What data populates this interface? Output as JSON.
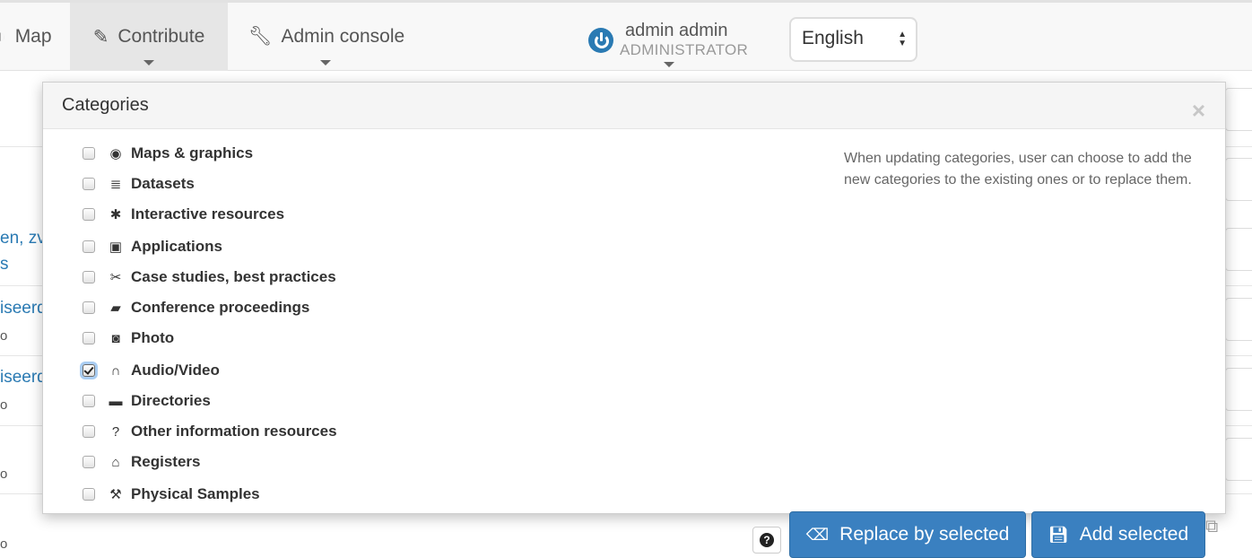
{
  "navbar": {
    "map_label": "Map",
    "contribute_label": "Contribute",
    "admin_label": "Admin console",
    "user_name": "admin admin",
    "user_role": "ADMINISTRATOR",
    "language": "English"
  },
  "background": {
    "link1": "en, zv",
    "link1b": "s",
    "link2": "iseerd",
    "link3": "iseerd",
    "small": "o"
  },
  "modal": {
    "title": "Categories",
    "close": "×",
    "help_text": "When updating categories, user can choose to add the new categories to the existing ones or to replace them.",
    "categories": [
      {
        "label": "Maps & graphics",
        "icon": "globe-icon",
        "checked": false
      },
      {
        "label": "Datasets",
        "icon": "database-icon",
        "checked": false
      },
      {
        "label": "Interactive resources",
        "icon": "gear-icon",
        "checked": false
      },
      {
        "label": "Applications",
        "icon": "floppy-disk-icon",
        "checked": false
      },
      {
        "label": "Case studies, best practices",
        "icon": "paperclip-icon",
        "checked": false
      },
      {
        "label": "Conference proceedings",
        "icon": "book-icon",
        "checked": false
      },
      {
        "label": "Photo",
        "icon": "camera-icon",
        "checked": false
      },
      {
        "label": "Audio/Video",
        "icon": "headphones-icon",
        "checked": true
      },
      {
        "label": "Directories",
        "icon": "folder-icon",
        "checked": false
      },
      {
        "label": "Other information resources",
        "icon": "question-icon",
        "checked": false
      },
      {
        "label": "Registers",
        "icon": "institution-icon",
        "checked": false
      },
      {
        "label": "Physical Samples",
        "icon": "wrench-icon",
        "checked": false
      }
    ]
  },
  "actions": {
    "replace_label": "Replace by selected",
    "add_label": "Add selected",
    "help_glyph": "?"
  },
  "colors": {
    "primary": "#3a80c0",
    "link": "#2a7ab3"
  }
}
